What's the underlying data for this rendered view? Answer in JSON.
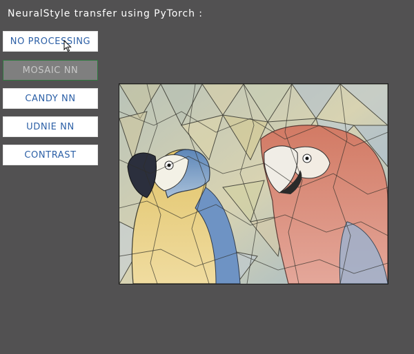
{
  "title": "NeuralStyle transfer using PyTorch :",
  "buttons": {
    "no_processing": "NO PROCESSING",
    "mosaic_nn": "MOSAIC NN",
    "candy_nn": "CANDY NN",
    "udnie_nn": "UDNIE NN",
    "contrast": "CONTRAST"
  },
  "active_button": "MOSAIC NN",
  "image": {
    "subject": "two macaw parrots in mosaic stained-glass style"
  },
  "colors": {
    "background": "#525152",
    "button_bg": "#ffffff",
    "button_text": "#2b5fa6",
    "active_bg": "#7f7f7f",
    "active_text": "#c9c9c9",
    "active_border": "#2f7a3f",
    "title_text": "#ffffff"
  }
}
